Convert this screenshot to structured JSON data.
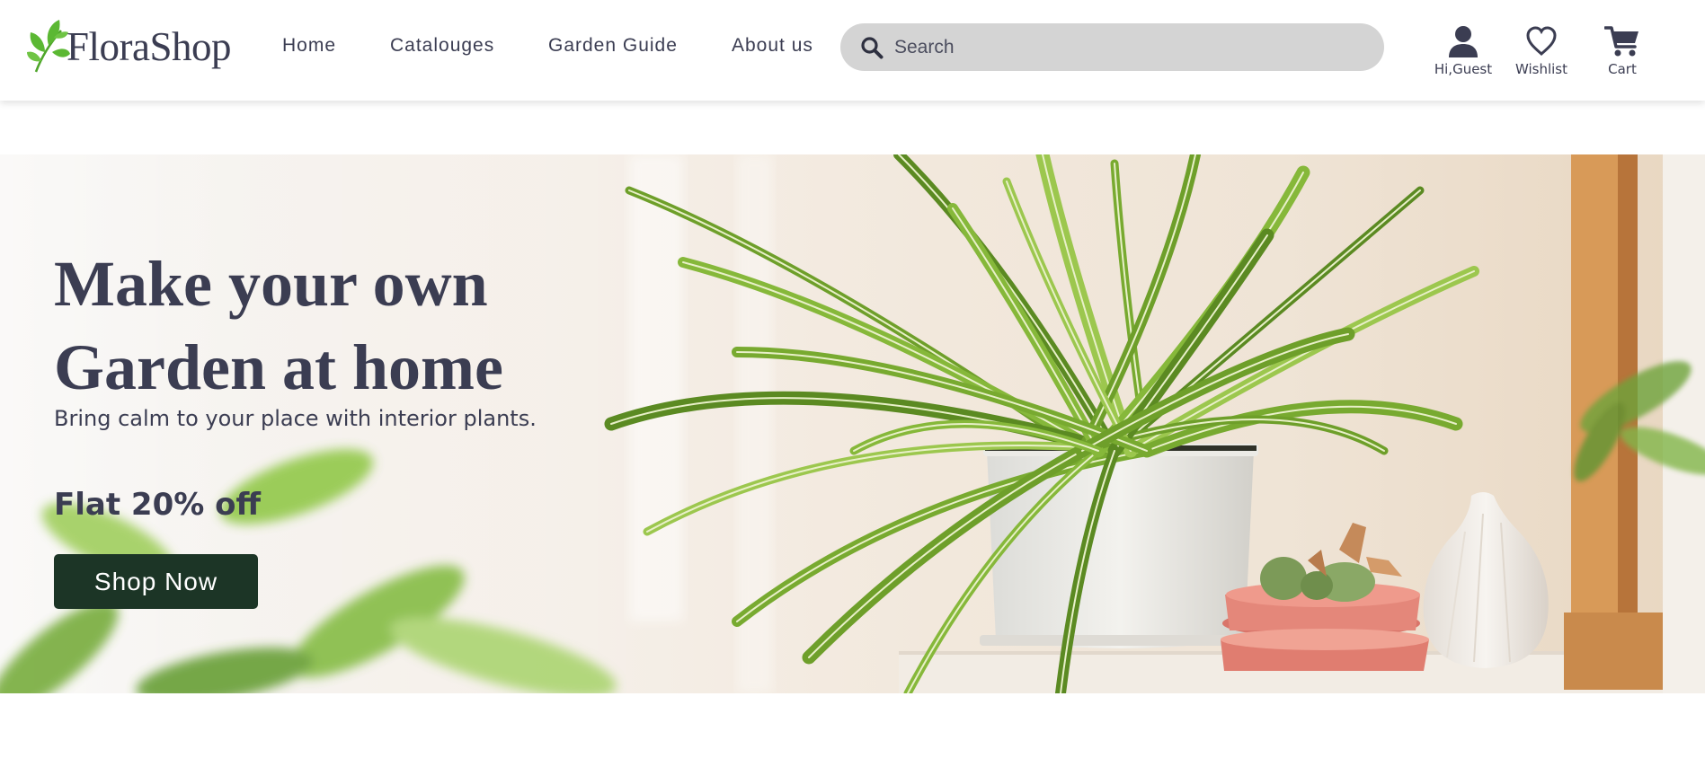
{
  "brand": {
    "name": "FloraShop",
    "logo_icon": "leaf-sprig-icon",
    "accent_color": "#5bb833"
  },
  "nav": [
    {
      "label": "Home"
    },
    {
      "label": "Catalouges"
    },
    {
      "label": "Garden Guide"
    },
    {
      "label": "About us"
    }
  ],
  "search": {
    "placeholder": "Search",
    "value": "",
    "icon": "search-icon"
  },
  "header_actions": {
    "account": {
      "label": "Hi,Guest",
      "icon": "user-icon"
    },
    "wishlist": {
      "label": "Wishlist",
      "icon": "heart-icon"
    },
    "cart": {
      "label": "Cart",
      "icon": "cart-icon"
    }
  },
  "hero": {
    "title_line1": "Make your own",
    "title_line2": "Garden at home",
    "subtitle": "Bring calm to your place with interior plants.",
    "offer": "Flat 20% off",
    "cta_label": "Shop Now",
    "cta_color": "#1c3526",
    "text_color": "#3b3d52"
  }
}
